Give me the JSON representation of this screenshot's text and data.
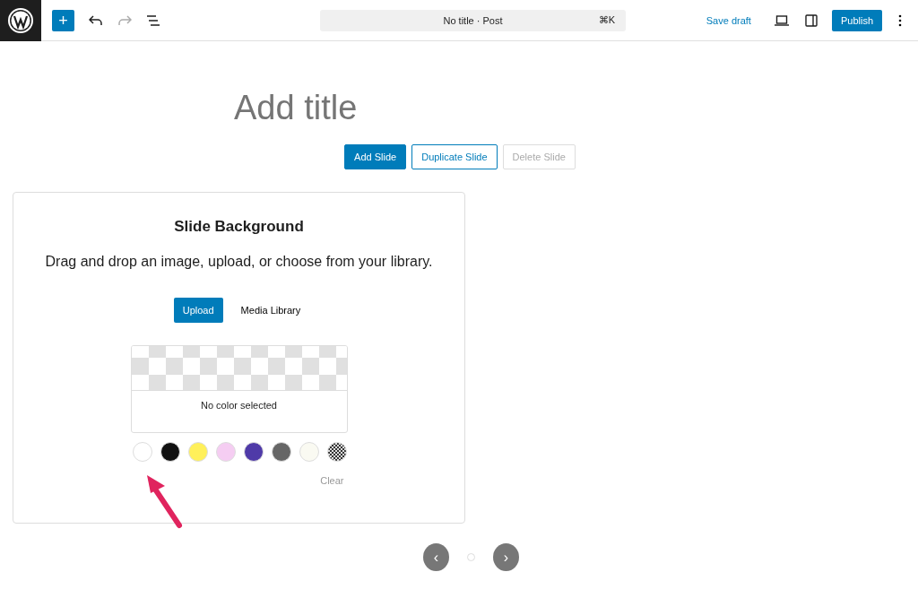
{
  "toolbar": {
    "add_label": "+",
    "command": {
      "title": "No title · Post",
      "shortcut": "⌘K"
    },
    "save_draft": "Save draft",
    "publish": "Publish"
  },
  "title_placeholder": "Add title",
  "slide_buttons": [
    {
      "label": "Add Slide",
      "kind": "primary"
    },
    {
      "label": "Duplicate Slide",
      "kind": "outline"
    },
    {
      "label": "Delete Slide",
      "kind": "disabled"
    }
  ],
  "background": {
    "heading": "Slide Background",
    "instructions": "Drag and drop an image, upload, or choose from your library.",
    "upload": "Upload",
    "media_library": "Media Library",
    "preview_text": "No color selected",
    "swatches": [
      {
        "kind": "solid",
        "color": "#ffffff"
      },
      {
        "kind": "solid",
        "color": "#111111"
      },
      {
        "kind": "solid",
        "color": "#fff05a"
      },
      {
        "kind": "solid",
        "color": "#f5cdf2"
      },
      {
        "kind": "solid",
        "color": "#4f3aa8"
      },
      {
        "kind": "solid",
        "color": "#666666"
      },
      {
        "kind": "solid",
        "color": "#fafaf2"
      },
      {
        "kind": "pattern"
      }
    ],
    "clear": "Clear"
  },
  "pager": {
    "prev": "‹",
    "next": "›"
  }
}
